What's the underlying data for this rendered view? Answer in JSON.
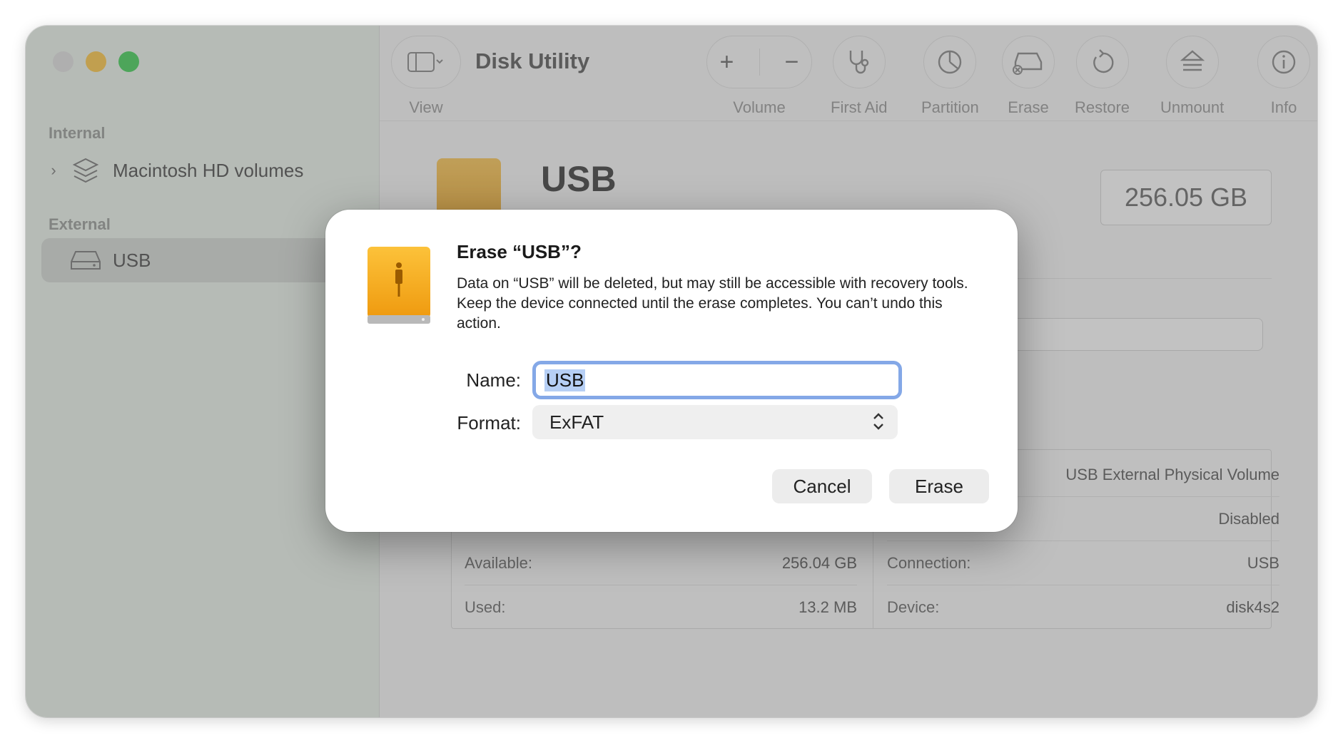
{
  "window": {
    "title": "Disk Utility"
  },
  "sidebar": {
    "sections": [
      {
        "label": "Internal"
      },
      {
        "label": "External"
      }
    ],
    "items": [
      {
        "label": "Macintosh HD  volumes",
        "icon": "layers-icon"
      },
      {
        "label": "USB",
        "icon": "drive-icon",
        "selected": true
      }
    ]
  },
  "toolbar": {
    "view_label": "View",
    "volume_label": "Volume",
    "first_aid_label": "First Aid",
    "partition_label": "Partition",
    "erase_label": "Erase",
    "restore_label": "Restore",
    "unmount_label": "Unmount",
    "info_label": "Info"
  },
  "disk": {
    "name": "USB",
    "capacity": "256.05 GB"
  },
  "info_table": {
    "left": [
      {
        "key": "Available:",
        "value": "256.04 GB"
      },
      {
        "key": "Used:",
        "value": "13.2 MB"
      }
    ],
    "right": [
      {
        "key": "",
        "value": "USB External Physical Volume"
      },
      {
        "key": "",
        "value": "Disabled"
      },
      {
        "key": "Connection:",
        "value": "USB"
      },
      {
        "key": "Device:",
        "value": "disk4s2"
      }
    ]
  },
  "dialog": {
    "title": "Erase “USB”?",
    "message": "Data on “USB” will be deleted, but may still be accessible with recovery tools. Keep the device connected until the erase completes. You can’t undo this action.",
    "name_label": "Name:",
    "name_value": "USB",
    "format_label": "Format:",
    "format_value": "ExFAT",
    "cancel_label": "Cancel",
    "erase_label": "Erase"
  },
  "colors": {
    "accent_focus": "#84a8e7",
    "drive_orange": "#f1a51e",
    "sidebar_bg": "#eaf3e9"
  }
}
